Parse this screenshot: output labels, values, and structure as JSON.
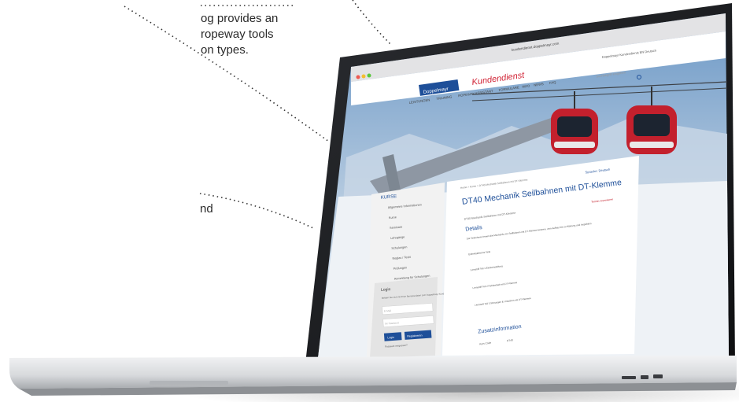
{
  "callouts": {
    "top_lines": [
      "og provides an",
      "ropeway tools",
      "on types."
    ],
    "mid_fragment": "nd"
  },
  "browser": {
    "url": "kundendienst.doppelmayr.com",
    "topbar_right": "Doppelmayr Kundendienst   EN   Deutsch"
  },
  "site": {
    "logo": "Doppelmayr",
    "portal_title": "Kundendienst",
    "nav": [
      "LEISTUNGEN",
      "TRAINING",
      "ROPEWAY ASSISTANT",
      "FORMULARE",
      "INFO",
      "NEWS",
      "FAQ"
    ],
    "search_placeholder": "Suchbegriff eingeben"
  },
  "sidebar": {
    "heading": "KURSE",
    "items": [
      "Allgemeine Informationen",
      "Kurse",
      "Seminare",
      "Lehrgänge",
      "Schulungen",
      "Reglas / Tests",
      "Prüfungen",
      "Anmeldung für Schulungen"
    ],
    "login": {
      "heading": "Login",
      "text": "Melden Sie sich mit Ihren Benutzerdaten zum Doppelmayr Kunden-Portal an.",
      "user_placeholder": "E-Mail",
      "pass_placeholder": "Ihr Passwort",
      "login_button": "Login",
      "register_button": "Registrieren",
      "forgot": "Passwort vergessen?"
    }
  },
  "content": {
    "breadcrumb": "Home > Kurse > DT40 Mechanik Seilbahnen mit DT-Klemme",
    "language_switch": "Sprache: Deutsch",
    "title": "DT40 Mechanik Seilbahnen mit DT-Klemme",
    "subtitle": "DT40 Mechanik Seilbahnen mit DT-Klemme",
    "register_link": "Termin reservieren",
    "section_details": "Details",
    "details_paras": [
      "Die Teilnehmer lernen die Mechanik von Seilbahnen mit DT-Klemme kennen, vom Aufbau bis zu Wartung und Inspektion",
      "Einheitsklemme Teile",
      "Lernstoff Teil 1 Einsteinstellung",
      "Lernstoff Teil 2 Fahrbetrieb mit DT-Klemme",
      "Lernstoff Teil 3 Störungen & Ursachen mit DT-Klemme"
    ],
    "section_extra": "Zusatzinformation",
    "info_label": "Kurs Code",
    "info_value": "DT40"
  }
}
